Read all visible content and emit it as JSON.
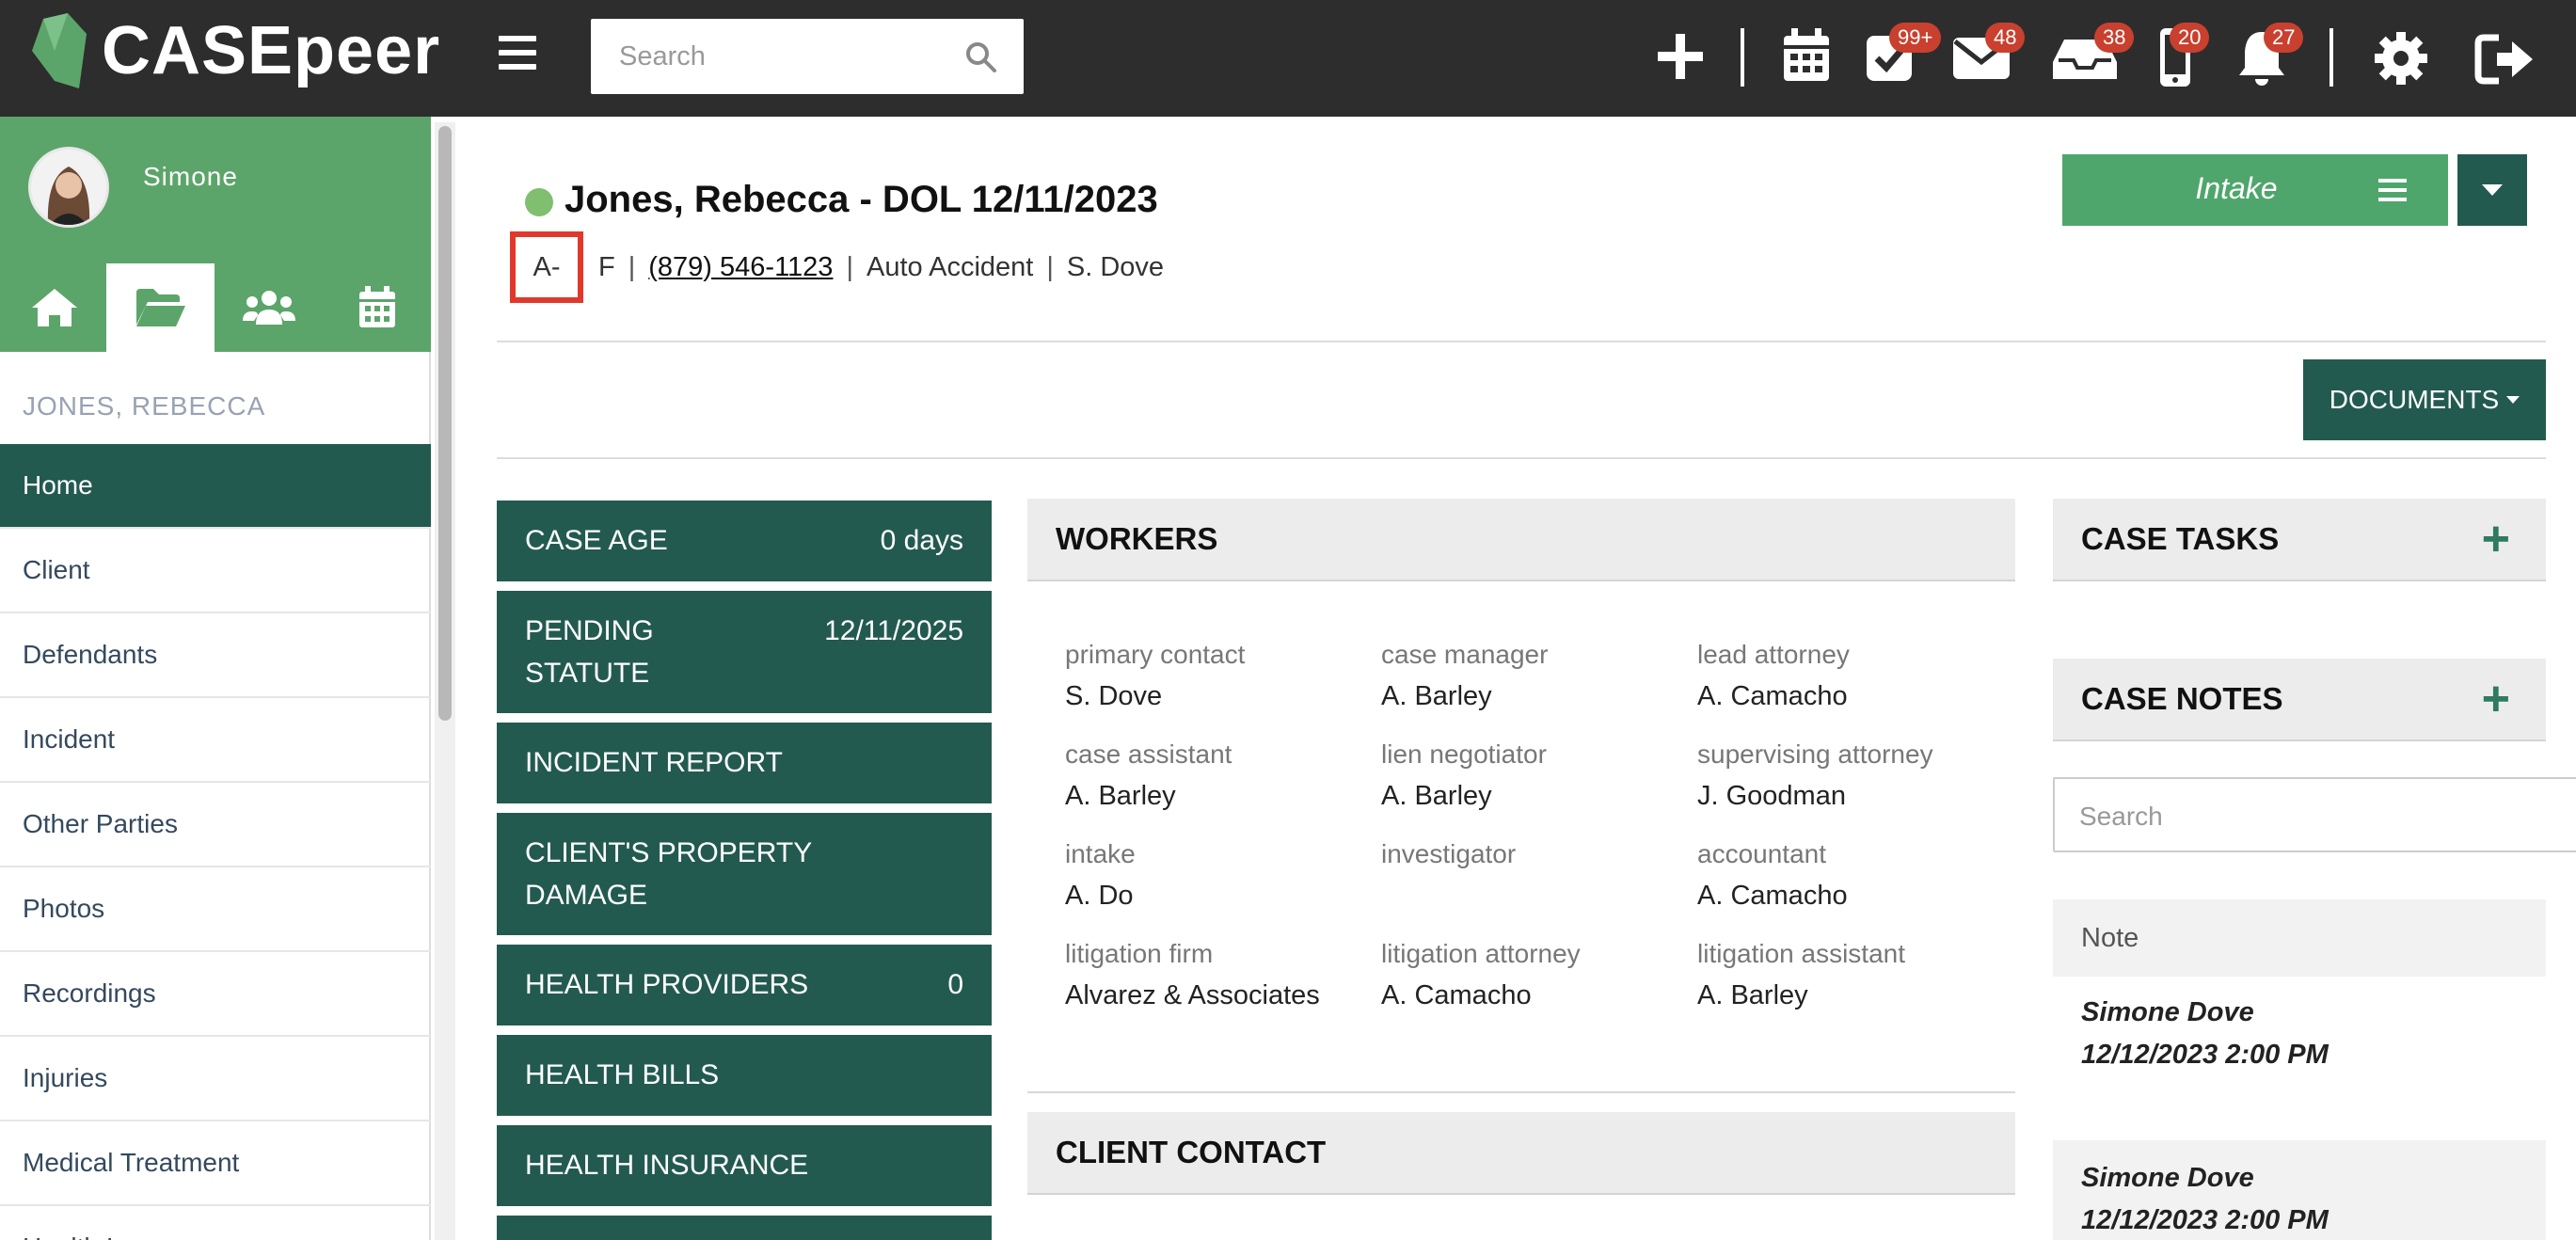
{
  "app": {
    "name": "CASEpeer"
  },
  "topbar": {
    "search_placeholder": "Search",
    "badges": {
      "tasks": "99+",
      "mail": "48",
      "inbox": "38",
      "phone": "20",
      "notifications": "27"
    }
  },
  "sidebar": {
    "username": "Simone",
    "case_name": "JONES, REBECCA",
    "items": [
      {
        "label": "Home"
      },
      {
        "label": "Client"
      },
      {
        "label": "Defendants"
      },
      {
        "label": "Incident"
      },
      {
        "label": "Other Parties"
      },
      {
        "label": "Photos"
      },
      {
        "label": "Recordings"
      },
      {
        "label": "Injuries"
      },
      {
        "label": "Medical Treatment"
      },
      {
        "label": "Health Insurance"
      }
    ]
  },
  "case": {
    "title": "Jones, Rebecca - DOL 12/11/2023",
    "blood_type": "A-",
    "sex": "F",
    "phone": "(879) 546-1123",
    "case_type": "Auto Accident",
    "attorney": "S. Dove",
    "stage": "Intake",
    "documents_label": "DOCUMENTS"
  },
  "tiles": [
    {
      "label": "CASE AGE",
      "value": "0 days"
    },
    {
      "label": "PENDING STATUTE",
      "value": "12/11/2025"
    },
    {
      "label": "INCIDENT REPORT",
      "value": ""
    },
    {
      "label": "CLIENT'S PROPERTY DAMAGE",
      "value": ""
    },
    {
      "label": "HEALTH PROVIDERS",
      "value": "0"
    },
    {
      "label": "HEALTH BILLS",
      "value": ""
    },
    {
      "label": "HEALTH INSURANCE",
      "value": ""
    }
  ],
  "workers": {
    "title": "WORKERS",
    "items": [
      {
        "role": "primary contact",
        "name": "S. Dove"
      },
      {
        "role": "case manager",
        "name": "A. Barley"
      },
      {
        "role": "lead attorney",
        "name": "A. Camacho"
      },
      {
        "role": "case assistant",
        "name": "A. Barley"
      },
      {
        "role": "lien negotiator",
        "name": "A. Barley"
      },
      {
        "role": "supervising attorney",
        "name": "J. Goodman"
      },
      {
        "role": "intake",
        "name": "A. Do"
      },
      {
        "role": "investigator",
        "name": ""
      },
      {
        "role": "accountant",
        "name": "A. Camacho"
      },
      {
        "role": "litigation firm",
        "name": "Alvarez & Associates"
      },
      {
        "role": "litigation attorney",
        "name": "A. Camacho"
      },
      {
        "role": "litigation assistant",
        "name": "A. Barley"
      }
    ]
  },
  "client_contact": {
    "title": "CLIENT CONTACT"
  },
  "case_tasks": {
    "title": "CASE TASKS"
  },
  "case_notes": {
    "title": "CASE NOTES",
    "search_placeholder": "Search",
    "column_header": "Note",
    "notes": [
      {
        "author": "Simone Dove",
        "datetime": "12/12/2023 2:00 PM"
      },
      {
        "author": "Simone Dove",
        "datetime": "12/12/2023 2:00 PM"
      }
    ]
  },
  "colors": {
    "topbar": "#2d2d2d",
    "brand_green": "#5ca56a",
    "dark_teal": "#235a50",
    "badge_red": "#c9402e",
    "highlight_red": "#e0392b"
  }
}
